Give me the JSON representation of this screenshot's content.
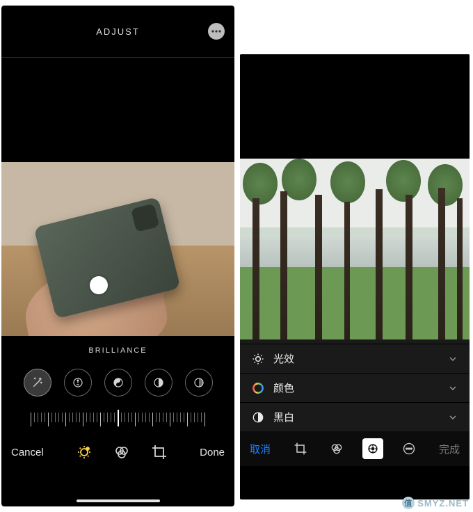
{
  "left": {
    "header": {
      "title": "ADJUST"
    },
    "subheader": "BRILLIANCE",
    "dials": [
      {
        "name": "auto-enhance",
        "active": true
      },
      {
        "name": "exposure",
        "active": false
      },
      {
        "name": "brilliance",
        "active": false
      },
      {
        "name": "highlights",
        "active": false
      },
      {
        "name": "shadows",
        "active": false
      }
    ],
    "bottom": {
      "cancel": "Cancel",
      "done": "Done",
      "tools": [
        {
          "name": "adjust",
          "selected": true
        },
        {
          "name": "filters",
          "selected": false
        },
        {
          "name": "crop",
          "selected": false
        }
      ]
    }
  },
  "right": {
    "rows": [
      {
        "icon": "light-icon",
        "label": "光效"
      },
      {
        "icon": "color-icon",
        "label": "颜色"
      },
      {
        "icon": "bw-icon",
        "label": "黑白"
      }
    ],
    "bottom": {
      "cancel": "取消",
      "done": "完成",
      "tools": [
        {
          "name": "crop",
          "on": false
        },
        {
          "name": "filters",
          "on": false
        },
        {
          "name": "adjust",
          "on": true
        },
        {
          "name": "more",
          "on": false
        }
      ]
    }
  },
  "watermark": "SMYZ.NET"
}
